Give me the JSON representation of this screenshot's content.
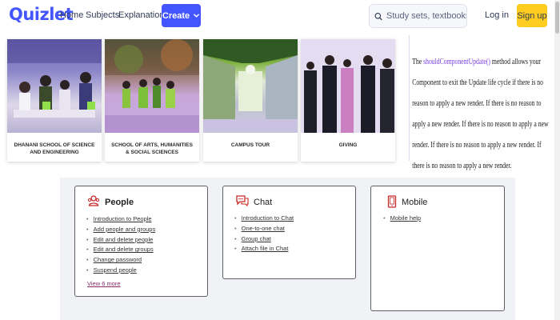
{
  "header": {
    "logo": "Quizlet",
    "nav": [
      "Home",
      "Subjects",
      "Explanations"
    ],
    "create_label": "Create",
    "search_placeholder": "Study sets, textbooks, ...",
    "login_label": "Log in",
    "signup_label": "Sign up",
    "brand_color": "#4255ff",
    "signup_color": "#ffcd1f"
  },
  "cards": [
    {
      "label": "DHANANI SCHOOL OF SCIENCE AND ENGINEERING"
    },
    {
      "label": "SCHOOL OF ARTS, HUMANITIES & SOCIAL SCIENCES"
    },
    {
      "label": "CAMPUS TOUR"
    },
    {
      "label": "GIVING"
    }
  ],
  "tooltip": {
    "before": "The ",
    "code": "shouldComponentUpdate()",
    "after": " method allows your Component to exit the Update life cycle if there is no reason to apply a new render. If there is no reason to apply a new render. If there is no reason to apply a new render. If there is no reason to apply a new render. If there is no reason to apply a new render."
  },
  "help": {
    "people": {
      "title": "People",
      "icon": "people-icon",
      "items": [
        "Introduction to People",
        "Add people and groups",
        "Edit and delete people",
        "Edit and delete groups",
        "Change password",
        "Suspend people"
      ],
      "view_more": "View 6 more"
    },
    "chat": {
      "title": "Chat",
      "icon": "chat-icon",
      "items": [
        "Introduction to Chat",
        "One-to-one chat",
        "Group chat",
        "Attach file in Chat"
      ]
    },
    "mobile": {
      "title": "Mobile",
      "icon": "mobile-icon",
      "items": [
        "Mobile help"
      ]
    }
  }
}
